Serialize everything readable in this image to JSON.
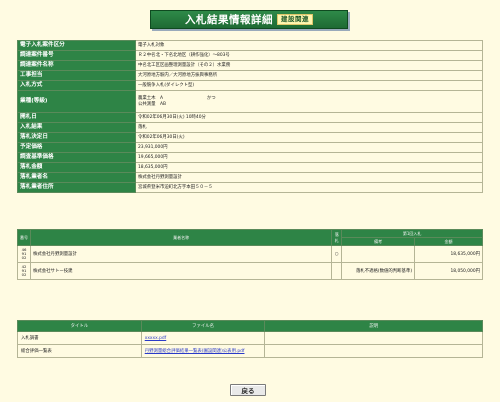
{
  "page": {
    "title": "入札結果情報詳細",
    "title_tag": "建設関連"
  },
  "info": [
    {
      "label": "電子入札案件区分",
      "value": "電子入札対象"
    },
    {
      "label": "調達案件番号",
      "value": "Ｒ２中名北・下名北地区（耕作強化）～803号"
    },
    {
      "label": "調達案件名称",
      "value": "中名北工区区画整理測量設計（その２）水業務"
    },
    {
      "label": "工事担当",
      "value": "大河原地方駅内／大河原地方振興事務所"
    },
    {
      "label": "入札方式",
      "value": "一般競争入札(ダイレクト型)"
    },
    {
      "label": "業種(等級)",
      "value_lines": [
        "農業土木　A　　　　　　　　　　かつ",
        "公共測量　AB"
      ]
    },
    {
      "label": "開札日",
      "value": "令和02年06月30日(火) 10時40分"
    },
    {
      "label": "入札結果",
      "value": "落札"
    },
    {
      "label": "落札決定日",
      "value": "令和02年06月30日(火)"
    },
    {
      "label": "予定価格",
      "value": "23,931,000円"
    },
    {
      "label": "調査基準価格",
      "value": "19,665,000円"
    },
    {
      "label": "落札金額",
      "value": "18,635,000円"
    },
    {
      "label": "落札業者名",
      "value": "株式会社丹野測量設計"
    },
    {
      "label": "落札業者住所",
      "value": "宮城県登米市迫町北方字本田５０－５"
    }
  ],
  "bids": {
    "headers": {
      "no": "番号",
      "name": "業者名称",
      "result": "落札",
      "bid_group": "第1回入札",
      "remark": "備考",
      "amount": "金額"
    },
    "rows": [
      {
        "no": "46\n91\n02",
        "name": "株式会社丹野測量設計",
        "mark": "○",
        "remark": "",
        "amount": "18,635,000円"
      },
      {
        "no": "42\n91\n02",
        "name": "株式会社サトー技建",
        "mark": "",
        "remark": "落札不適格(数値的判断基準)",
        "amount": "18,050,000円"
      }
    ]
  },
  "files": {
    "headers": {
      "title": "タイトル",
      "file": "ファイル名",
      "desc": "説明"
    },
    "rows": [
      {
        "title": "入札調書",
        "file": "xxxxx.pdf",
        "desc": ""
      },
      {
        "title": "総合評価一覧表",
        "file": "丹野測量総合評価結果一覧表(園設関連)公表用.pdf",
        "desc": ""
      }
    ]
  },
  "back_button": {
    "label": "戻る"
  }
}
